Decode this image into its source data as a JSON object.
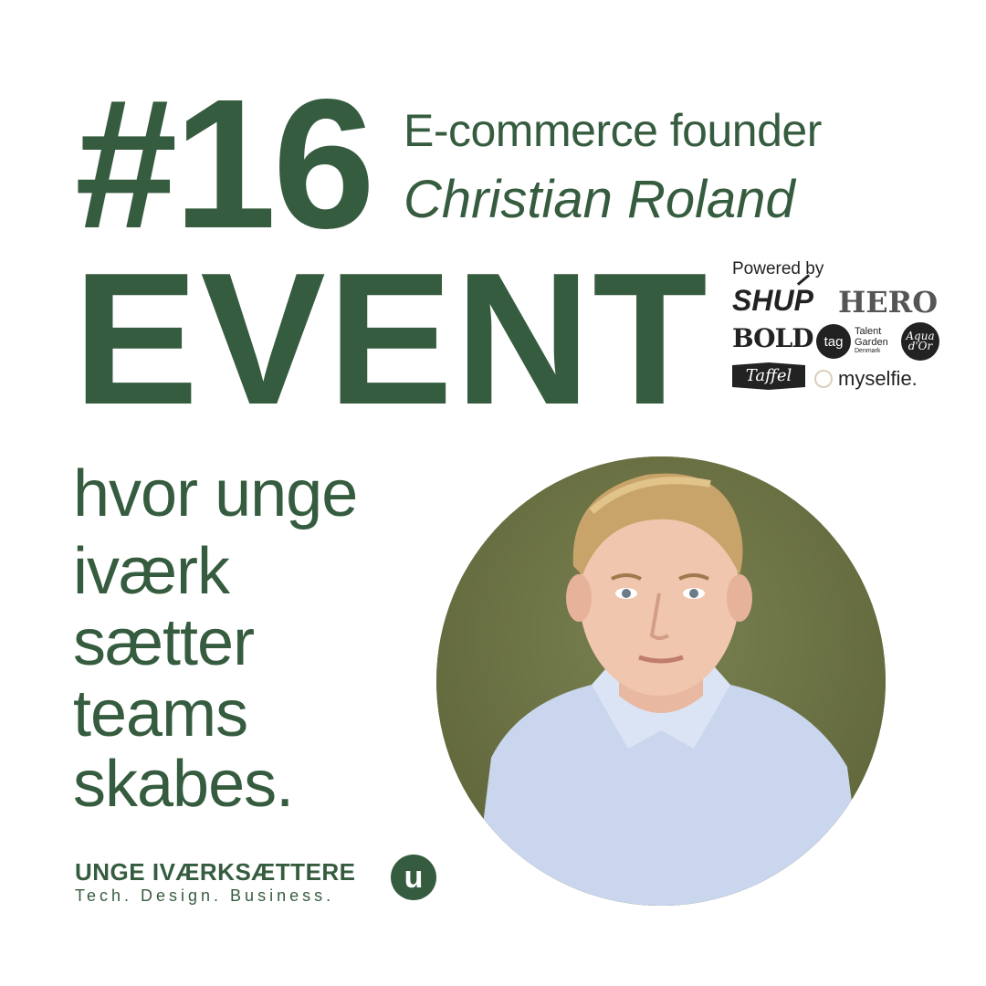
{
  "headline": {
    "number": "#16",
    "word": "EVENT",
    "role": "E-commerce founder",
    "name": "Christian Roland"
  },
  "sponsors": {
    "powered_by": "Powered by",
    "logos": [
      "SHUP",
      "HERO",
      "BOLD",
      "tag",
      "Talent",
      "Garden",
      "Denmark",
      "Aqua",
      "d'Or",
      "Taffel",
      "myselfie."
    ]
  },
  "tagline": [
    "hvor unge",
    "iværk",
    "sætter",
    "teams",
    "skabes."
  ],
  "brand": {
    "name": "UNGE IVÆRKSÆTTERE",
    "slogan": "Tech. Design. Business.",
    "badge": "u"
  },
  "colors": {
    "primary": "#365c3f",
    "portrait_background": "#6f7646"
  },
  "icons": {
    "portrait": "person-portrait",
    "badge": "brand-u-badge"
  }
}
